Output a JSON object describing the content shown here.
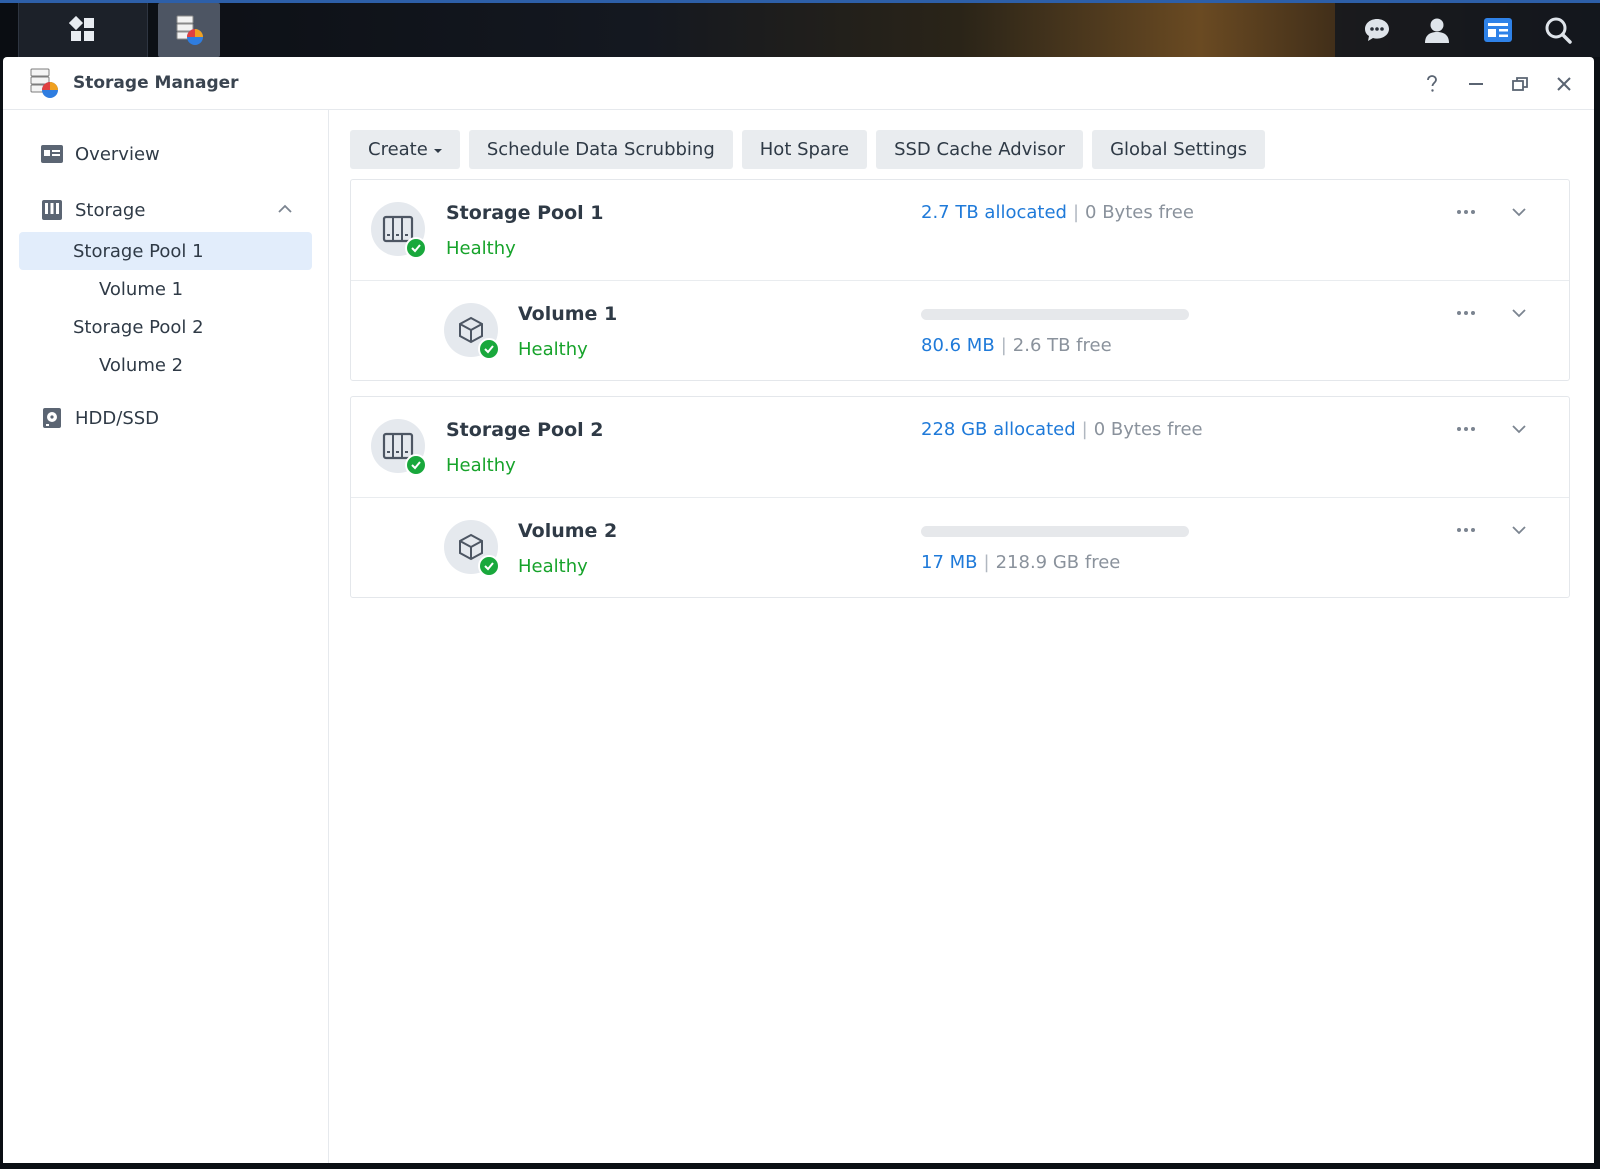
{
  "window": {
    "title": "Storage Manager"
  },
  "sidebar": {
    "overview": "Overview",
    "storage": "Storage",
    "pools": [
      {
        "label": "Storage Pool 1",
        "volume": "Volume 1"
      },
      {
        "label": "Storage Pool 2",
        "volume": "Volume 2"
      }
    ],
    "hdd": "HDD/SSD"
  },
  "toolbar": {
    "create": "Create",
    "scrub": "Schedule Data Scrubbing",
    "hot_spare": "Hot Spare",
    "ssd_cache": "SSD Cache Advisor",
    "global": "Global Settings"
  },
  "pools": [
    {
      "name": "Storage Pool 1",
      "status": "Healthy",
      "allocated": "2.7 TB allocated",
      "free": "0 Bytes free",
      "volume": {
        "name": "Volume 1",
        "status": "Healthy",
        "used": "80.6 MB",
        "free": "2.6 TB free",
        "usage_fraction": 0.0
      }
    },
    {
      "name": "Storage Pool 2",
      "status": "Healthy",
      "allocated": "228 GB allocated",
      "free": "0 Bytes free",
      "volume": {
        "name": "Volume 2",
        "status": "Healthy",
        "used": "17 MB",
        "free": "218.9 GB free",
        "usage_fraction": 0.0
      }
    }
  ],
  "colors": {
    "accent": "#1f7ad9",
    "healthy": "#17a32b",
    "selected_bg": "#e2edfb"
  },
  "separator": "|"
}
